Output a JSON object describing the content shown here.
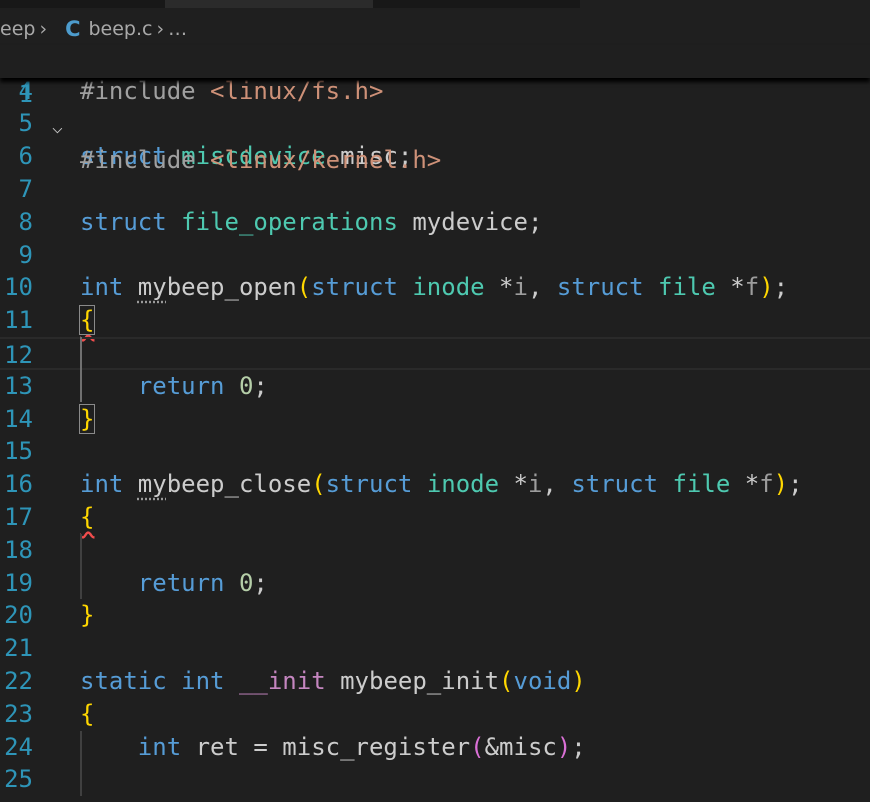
{
  "breadcrumb": {
    "folder": "eep",
    "file_icon": "C",
    "file": "beep.c",
    "more": "…"
  },
  "colors": {
    "keyword": "#569cd6",
    "type": "#4ec9b0",
    "string": "#ce9178",
    "bracket1": "#ffd700",
    "bracket2": "#da70d6",
    "line_number": "#2e95b8"
  },
  "sticky": {
    "number": "1",
    "tokens": [
      [
        "#include ",
        "pp"
      ],
      [
        "<linux/kernel.h>",
        "st"
      ]
    ]
  },
  "lines": [
    {
      "n": "4",
      "t": [
        [
          "#include ",
          "pp"
        ],
        [
          "<linux/fs.h>",
          "st"
        ]
      ]
    },
    {
      "n": "5",
      "t": []
    },
    {
      "n": "6",
      "t": [
        [
          "struct ",
          "kw"
        ],
        [
          "miscdevice",
          "ty"
        ],
        [
          " misc;",
          ""
        ]
      ]
    },
    {
      "n": "7",
      "t": []
    },
    {
      "n": "8",
      "t": [
        [
          "struct ",
          "kw"
        ],
        [
          "file_operations",
          "ty"
        ],
        [
          " mydevice;",
          ""
        ]
      ]
    },
    {
      "n": "9",
      "t": []
    },
    {
      "n": "10",
      "t": [
        [
          "int ",
          "kw"
        ],
        [
          "my",
          "fn dot"
        ],
        [
          "beep_open",
          "fn"
        ],
        [
          "(",
          "b1"
        ],
        [
          "struct ",
          "kw"
        ],
        [
          "inode",
          "ty"
        ],
        [
          " *",
          ""
        ],
        [
          "i",
          "pa"
        ],
        [
          ", ",
          ""
        ],
        [
          "struct ",
          "kw"
        ],
        [
          "file",
          "ty"
        ],
        [
          " *",
          ""
        ],
        [
          "f",
          "pa"
        ],
        [
          ")",
          "b1"
        ],
        [
          ";",
          ""
        ]
      ]
    },
    {
      "n": "11",
      "t": [
        [
          "{",
          "b1 box sq"
        ]
      ]
    },
    {
      "n": "12",
      "t": [],
      "current": true
    },
    {
      "n": "13",
      "t": [
        [
          "    ",
          ""
        ],
        [
          "return ",
          "kw"
        ],
        [
          "0",
          "nu"
        ],
        [
          ";",
          ""
        ]
      ]
    },
    {
      "n": "14",
      "t": [
        [
          "}",
          "b1 box"
        ]
      ]
    },
    {
      "n": "15",
      "t": []
    },
    {
      "n": "16",
      "t": [
        [
          "int ",
          "kw"
        ],
        [
          "my",
          "fn dot"
        ],
        [
          "beep_close",
          "fn"
        ],
        [
          "(",
          "b1"
        ],
        [
          "struct ",
          "kw"
        ],
        [
          "inode",
          "ty"
        ],
        [
          " *",
          ""
        ],
        [
          "i",
          "pa"
        ],
        [
          ", ",
          ""
        ],
        [
          "struct ",
          "kw"
        ],
        [
          "file",
          "ty"
        ],
        [
          " *",
          ""
        ],
        [
          "f",
          "pa"
        ],
        [
          ")",
          "b1"
        ],
        [
          ";",
          ""
        ]
      ]
    },
    {
      "n": "17",
      "t": [
        [
          "{",
          "b1 sq"
        ]
      ]
    },
    {
      "n": "18",
      "t": []
    },
    {
      "n": "19",
      "t": [
        [
          "    ",
          ""
        ],
        [
          "return ",
          "kw"
        ],
        [
          "0",
          "nu"
        ],
        [
          ";",
          ""
        ]
      ]
    },
    {
      "n": "20",
      "t": [
        [
          "}",
          "b1"
        ]
      ]
    },
    {
      "n": "21",
      "t": []
    },
    {
      "n": "22",
      "t": [
        [
          "static ",
          "kw"
        ],
        [
          "int ",
          "kw"
        ],
        [
          "__init",
          "mc"
        ],
        [
          " mybeep_init",
          ""
        ],
        [
          "(",
          "b1"
        ],
        [
          "void",
          "kw"
        ],
        [
          ")",
          "b1"
        ]
      ]
    },
    {
      "n": "23",
      "t": [
        [
          "{",
          "b1"
        ]
      ]
    },
    {
      "n": "24",
      "t": [
        [
          "    ",
          ""
        ],
        [
          "int ",
          "kw"
        ],
        [
          "ret = misc_register",
          ""
        ],
        [
          "(",
          "b2"
        ],
        [
          "&misc",
          ""
        ],
        [
          ")",
          "b2"
        ],
        [
          ";",
          ""
        ]
      ]
    },
    {
      "n": "25",
      "t": []
    }
  ]
}
